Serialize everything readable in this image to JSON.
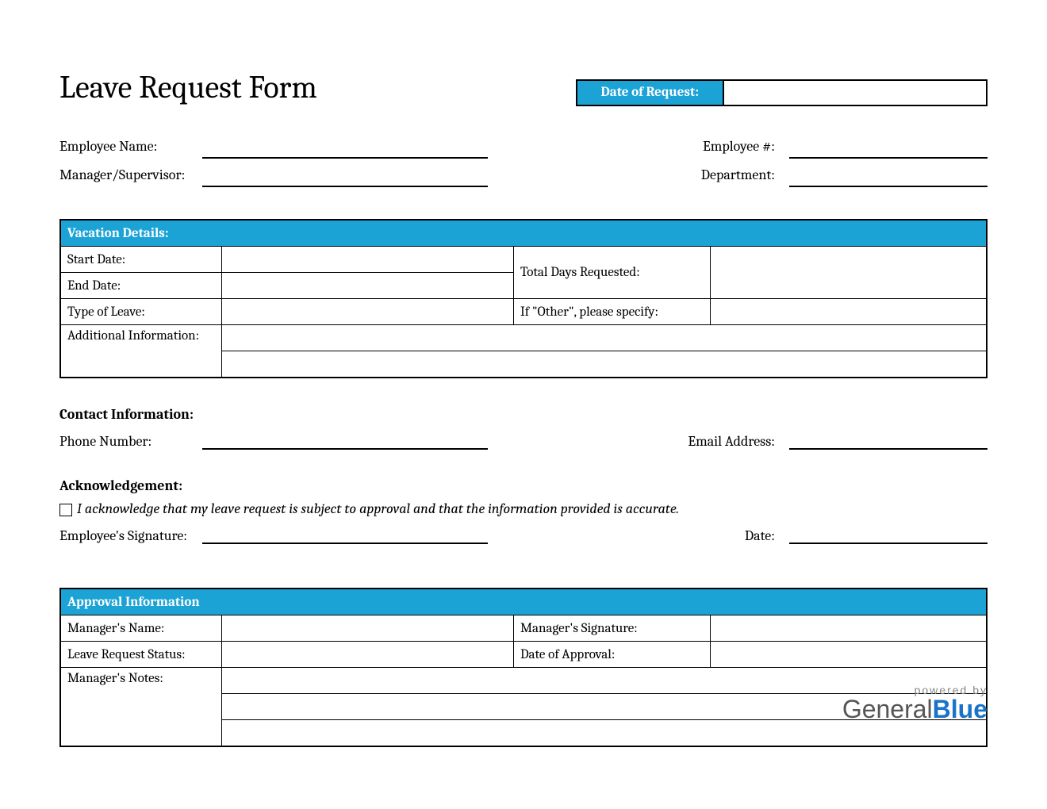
{
  "title": "Leave Request Form",
  "dateOfRequest": {
    "label": "Date of Request:"
  },
  "employeeInfo": {
    "name_label": "Employee Name:",
    "number_label": "Employee #:",
    "manager_label": "Manager/Supervisor:",
    "department_label": "Department:"
  },
  "vacation": {
    "header": "Vacation Details:",
    "start_date_label": "Start Date:",
    "end_date_label": "End Date:",
    "total_days_label": "Total Days Requested:",
    "type_label": "Type of Leave:",
    "other_label": "If \"Other\", please specify:",
    "additional_label": "Additional Information:"
  },
  "contact": {
    "header": "Contact Information:",
    "phone_label": "Phone Number:",
    "email_label": "Email Address:"
  },
  "ack": {
    "header": "Acknowledgement:",
    "text": "I acknowledge that my leave request is subject to approval and that the information provided is accurate.",
    "signature_label": "Employee's Signature:",
    "date_label": "Date:"
  },
  "approval": {
    "header": "Approval Information",
    "manager_name_label": "Manager's Name:",
    "manager_sig_label": "Manager's Signature:",
    "status_label": "Leave Request Status:",
    "approval_date_label": "Date of Approval:",
    "notes_label": "Manager's Notes:"
  },
  "footer": {
    "powered_by": "powered by",
    "brand_general": "General",
    "brand_blue": "Blue"
  }
}
